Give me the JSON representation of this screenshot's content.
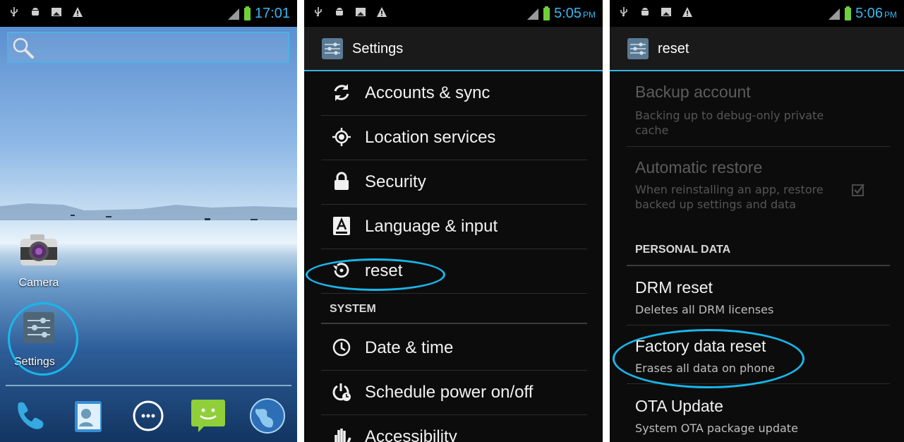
{
  "colors": {
    "accent": "#33b5e5",
    "highlight_circle": "#19b6ea",
    "clock": "#38b6f0"
  },
  "status_icons": [
    "usb-icon",
    "android-debug-icon",
    "sd-card-icon",
    "warning-icon"
  ],
  "screen1": {
    "time": "17:01",
    "search_icon": "magnifier-icon",
    "apps": [
      {
        "label": "Camera",
        "icon": "camera-icon"
      },
      {
        "label": "Settings",
        "icon": "settings-sliders-icon"
      }
    ],
    "dock": [
      "phone-icon",
      "contacts-icon",
      "app-drawer-icon",
      "messaging-icon",
      "browser-globe-icon"
    ]
  },
  "screen2": {
    "time": "5:05",
    "ampm": "PM",
    "title": "Settings",
    "items_top": [
      {
        "label": "Accounts & sync",
        "icon": "sync-icon"
      },
      {
        "label": "Location services",
        "icon": "location-target-icon"
      },
      {
        "label": "Security",
        "icon": "lock-icon"
      },
      {
        "label": "Language & input",
        "icon": "language-a-icon"
      },
      {
        "label": "reset",
        "icon": "backup-restore-icon"
      }
    ],
    "section": "SYSTEM",
    "items_bottom": [
      {
        "label": "Date & time",
        "icon": "clock-icon"
      },
      {
        "label": "Schedule power on/off",
        "icon": "power-schedule-icon"
      },
      {
        "label": "Accessibility",
        "icon": "hand-icon"
      }
    ]
  },
  "screen3": {
    "time": "5:06",
    "ampm": "PM",
    "title": "reset",
    "backup_account": {
      "title": "Backup account",
      "summary": "Backing up to debug-only private cache"
    },
    "auto_restore": {
      "title": "Automatic restore",
      "summary": "When reinstalling an app, restore backed up settings and data"
    },
    "section": "PERSONAL DATA",
    "drm": {
      "title": "DRM reset",
      "summary": "Deletes all DRM licenses"
    },
    "factory": {
      "title": "Factory data reset",
      "summary": "Erases all data on phone"
    },
    "ota": {
      "title": "OTA Update",
      "summary": "System OTA package update"
    }
  }
}
